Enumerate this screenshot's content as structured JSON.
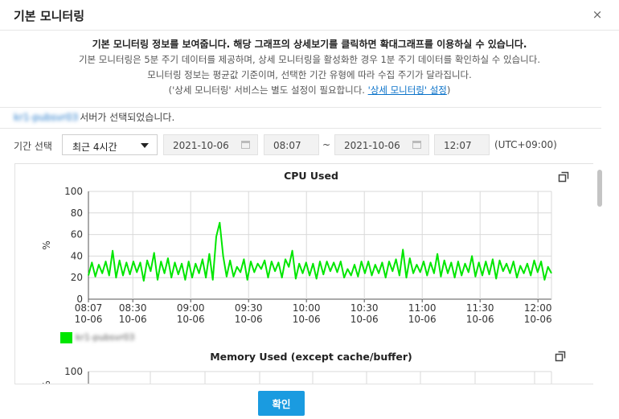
{
  "dialog": {
    "title": "기본 모니터링",
    "close_label": "×"
  },
  "intro": {
    "headline": "기본 모니터링 정보를 보여줍니다. 해당 그래프의 상세보기를 클릭하면 확대그래프를 이용하실 수 있습니다.",
    "line1": "기본 모니터링은 5분 주기 데이터를 제공하며, 상세 모니터링을 활성화한 경우 1분 주기 데이터를 확인하실 수 있습니다.",
    "line2": "모니터링 정보는 평균값 기준이며, 선택한 기간 유형에 따라 수집 주기가 달라집니다.",
    "line3_prefix": "('상세 모니터링' 서비스는 별도 설정이 필요합니다. ",
    "line3_link": "'상세 모니터링' 설정",
    "line3_suffix": ")"
  },
  "server": {
    "name": "kr1-pubsvr03",
    "suffix": "서버가 선택되었습니다."
  },
  "period": {
    "label": "기간 선택",
    "selected": "최근 4시간",
    "start_date": "2021-10-06",
    "start_time": "08:07",
    "separator": "~",
    "end_date": "2021-10-06",
    "end_time": "12:07",
    "timezone": "(UTC+09:00)"
  },
  "footer": {
    "ok_label": "확인"
  },
  "colors": {
    "series": "#00e600",
    "primary_button": "#1a9be0",
    "link": "#0a72c9"
  },
  "chart_data": [
    {
      "type": "line",
      "title": "CPU Used",
      "ylabel": "%",
      "ylim": [
        0,
        100
      ],
      "yticks": [
        0,
        20,
        40,
        60,
        80,
        100
      ],
      "xlim": [
        "08:07",
        "12:07"
      ],
      "xticks": [
        {
          "time": "08:07",
          "date": "10-06"
        },
        {
          "time": "08:30",
          "date": "10-06"
        },
        {
          "time": "09:00",
          "date": "10-06"
        },
        {
          "time": "09:30",
          "date": "10-06"
        },
        {
          "time": "10:00",
          "date": "10-06"
        },
        {
          "time": "10:30",
          "date": "10-06"
        },
        {
          "time": "11:00",
          "date": "10-06"
        },
        {
          "time": "11:30",
          "date": "10-06"
        },
        {
          "time": "12:00",
          "date": "10-06"
        }
      ],
      "grid": true,
      "legend": "bottom-left",
      "series": [
        {
          "name": "kr1-pubsvr03",
          "color": "#00e600",
          "values": [
            22,
            34,
            21,
            32,
            24,
            35,
            22,
            45,
            20,
            36,
            22,
            34,
            23,
            35,
            25,
            34,
            17,
            36,
            26,
            43,
            18,
            35,
            24,
            38,
            20,
            34,
            23,
            33,
            18,
            35,
            20,
            33,
            24,
            37,
            20,
            42,
            18,
            58,
            71,
            40,
            21,
            36,
            21,
            30,
            25,
            37,
            18,
            35,
            25,
            33,
            28,
            36,
            20,
            35,
            26,
            34,
            20,
            37,
            30,
            45,
            19,
            33,
            24,
            34,
            22,
            33,
            19,
            35,
            23,
            35,
            26,
            34,
            25,
            35,
            20,
            28,
            22,
            32,
            21,
            35,
            24,
            35,
            22,
            32,
            24,
            34,
            20,
            35,
            26,
            37,
            22,
            46,
            20,
            38,
            24,
            32,
            25,
            35,
            22,
            34,
            24,
            42,
            21,
            36,
            24,
            34,
            20,
            35,
            22,
            33,
            25,
            40,
            21,
            34,
            22,
            35,
            23,
            37,
            19,
            36,
            26,
            33,
            24,
            35,
            20,
            31,
            24,
            33,
            22,
            36,
            25,
            35,
            18,
            30,
            24
          ]
        }
      ]
    },
    {
      "type": "line",
      "title": "Memory Used (except cache/buffer)",
      "ylabel": "%",
      "ylim": [
        0,
        100
      ],
      "yticks": [
        100
      ],
      "grid": true
    }
  ]
}
